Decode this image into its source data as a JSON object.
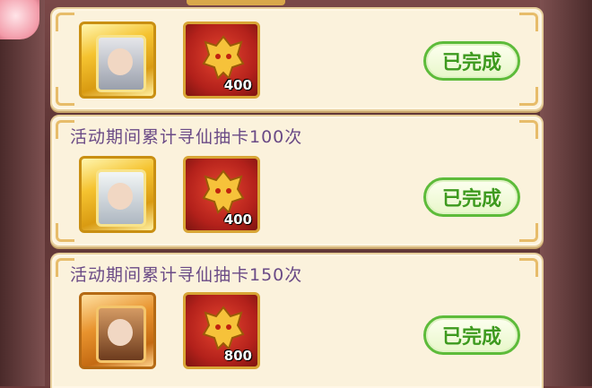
{
  "tasks": [
    {
      "title": "",
      "rewards": [
        {
          "type": "hero-card-elder",
          "frame": "gold"
        },
        {
          "type": "dragon-mask",
          "amount": "400"
        }
      ],
      "status_label": "已完成"
    },
    {
      "title": "活动期间累计寻仙抽卡100次",
      "rewards": [
        {
          "type": "hero-card-maiden",
          "frame": "gold"
        },
        {
          "type": "dragon-mask",
          "amount": "400"
        }
      ],
      "status_label": "已完成"
    },
    {
      "title": "活动期间累计寻仙抽卡150次",
      "rewards": [
        {
          "type": "hero-card-warrior",
          "frame": "orange"
        },
        {
          "type": "dragon-mask",
          "amount": "800"
        }
      ],
      "status_label": "已完成"
    }
  ],
  "colors": {
    "panel": "#fbf2dc",
    "title": "#6a4a86",
    "button_text": "#3e9a1f",
    "button_border": "#5dbb3a"
  }
}
